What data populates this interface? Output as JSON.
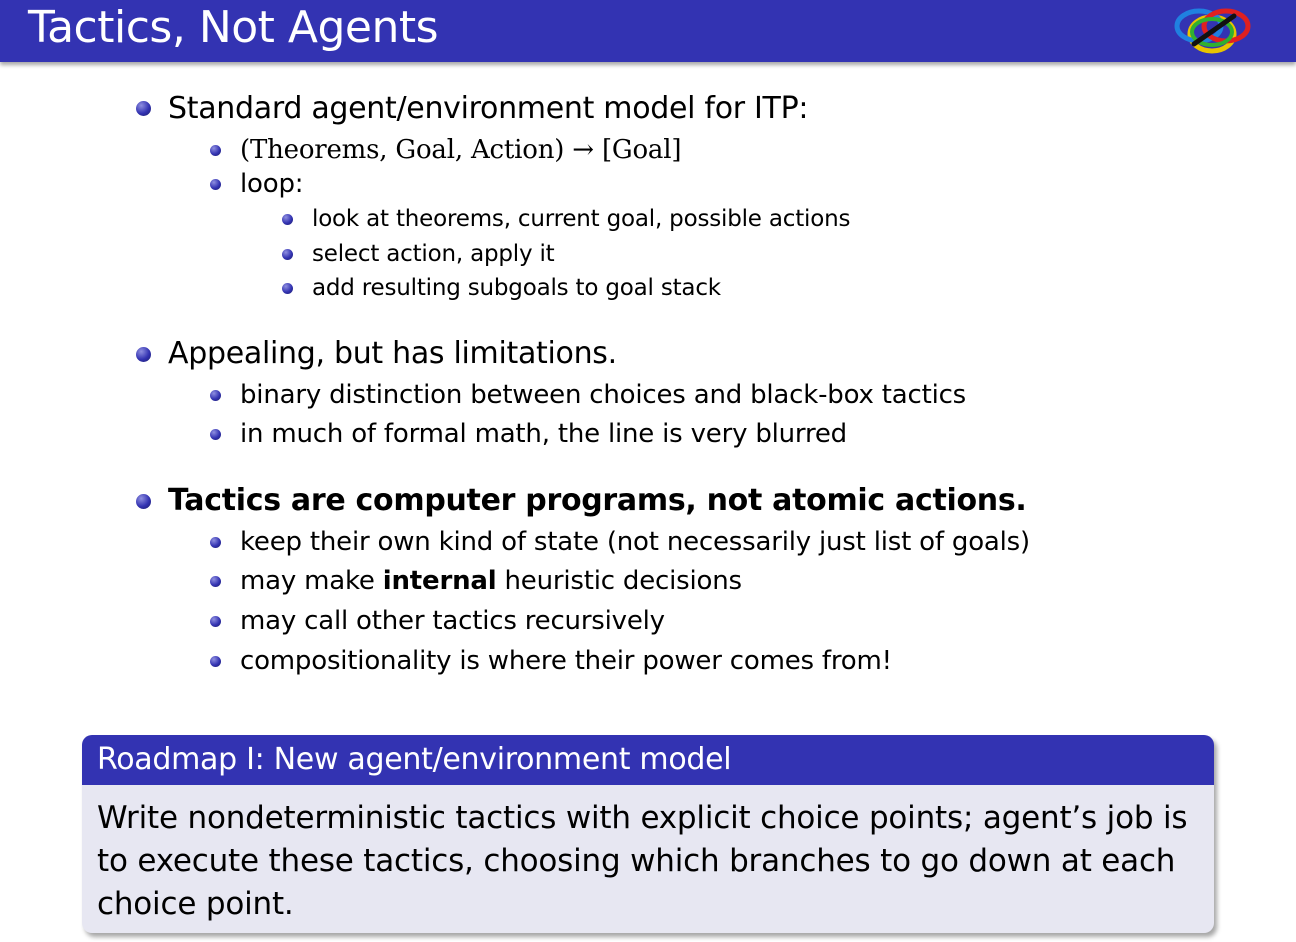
{
  "slide": {
    "title": "Tactics, Not Agents",
    "logo_icon": "tangled-rings-logo"
  },
  "sections": [
    {
      "text": "Standard agent/environment model for ITP:",
      "items": [
        {
          "text": "(Theorems, Goal, Action) → [Goal]"
        },
        {
          "text": "loop:",
          "items": [
            "look at theorems, current goal, possible actions",
            "select action, apply it",
            "add resulting subgoals to goal stack"
          ]
        }
      ]
    },
    {
      "text": "Appealing, but has limitations.",
      "items": [
        "binary distinction between choices and black-box tactics",
        "in much of formal math, the line is very blurred"
      ]
    },
    {
      "text": "Tactics are computer programs, not atomic actions.",
      "items": [
        "keep their own kind of state (not necessarily just list of goals)",
        {
          "before": "may make ",
          "bold": "internal",
          "after": " heuristic decisions"
        },
        "may call other tactics recursively",
        "compositionality is where their power comes from!"
      ]
    }
  ],
  "roadmap": {
    "title": "Roadmap I: New agent/environment model",
    "body_lines": [
      "Write nondeterministic tactics with explicit choice points; agent’s job is",
      "to execute these tactics, choosing which branches to go down at each",
      "choice point."
    ]
  },
  "colors": {
    "header_bg": "#3333b2",
    "block_body_bg": "#e7e7f2",
    "bullet": "#3333b2"
  }
}
